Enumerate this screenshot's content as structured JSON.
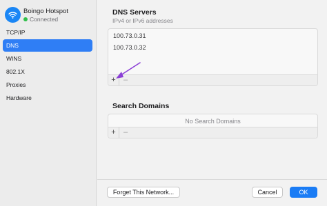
{
  "sidebar": {
    "network": {
      "name": "Boingo Hotspot",
      "status": "Connected",
      "icon": "wifi-icon"
    },
    "items": [
      {
        "label": "TCP/IP",
        "active": false
      },
      {
        "label": "DNS",
        "active": true
      },
      {
        "label": "WINS",
        "active": false
      },
      {
        "label": "802.1X",
        "active": false
      },
      {
        "label": "Proxies",
        "active": false
      },
      {
        "label": "Hardware",
        "active": false
      }
    ]
  },
  "dns": {
    "title": "DNS Servers",
    "subtitle": "IPv4 or IPv6 addresses",
    "servers": [
      "100.73.0.31",
      "100.73.0.32"
    ],
    "add_label": "+",
    "remove_label": "–"
  },
  "search_domains": {
    "title": "Search Domains",
    "empty_text": "No Search Domains",
    "add_label": "+",
    "remove_label": "–"
  },
  "footer": {
    "forget_label": "Forget This Network...",
    "cancel_label": "Cancel",
    "ok_label": "OK"
  },
  "colors": {
    "accent": "#2f7ef5",
    "status_connected": "#2fbf4a",
    "annotation_arrow": "#8b3fd6"
  }
}
